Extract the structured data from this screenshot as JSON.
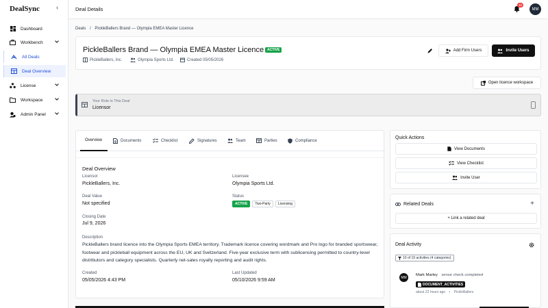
{
  "app": {
    "brand": "DealSync",
    "page_title": "Deal Details",
    "notification_count": "10",
    "user_initials": "MM"
  },
  "sidebar": {
    "items": [
      {
        "label": "Dashboard",
        "icon": "dashboard-icon"
      },
      {
        "label": "Workbench",
        "icon": "briefcase-icon",
        "expandable": true
      },
      {
        "label": "All Deals",
        "icon": "handshake-icon",
        "sub": true
      },
      {
        "label": "Deal Overview",
        "icon": "building-icon",
        "sub": true,
        "active": true
      },
      {
        "label": "License",
        "icon": "share-icon",
        "expandable": true
      },
      {
        "label": "Workspace",
        "icon": "folder-icon",
        "expandable": true
      },
      {
        "label": "Admin Panel",
        "icon": "shield-user-icon",
        "expandable": true
      }
    ]
  },
  "breadcrumb": {
    "root": "Deals",
    "separator": "/",
    "current": "PickleBallers Brand — Olympia EMEA Master Licence"
  },
  "deal": {
    "title": "PickleBallers Brand — Olympia EMEA Master Licence",
    "status": "ACTIVE",
    "licensor_meta": "PickleBallers, Inc.",
    "licensee_meta": "Olympia Sports Ltd.",
    "created_meta": "Created 05/05/2026"
  },
  "actions": {
    "add_firm_users": "Add Firm Users",
    "invite_users": "Invite Users",
    "open_workspace": "Open licence workspace"
  },
  "role": {
    "label": "Your Role in This Deal",
    "value": "Licensor"
  },
  "tabs": [
    "Overview",
    "Documents",
    "Checklist",
    "Signatures",
    "Team",
    "Parties",
    "Compliance"
  ],
  "overview": {
    "section_title": "Deal Overview",
    "licensor_label": "Licensor",
    "licensor_value": "PickleBallers, Inc.",
    "licensee_label": "Licensee",
    "licensee_value": "Olympia Sports Ltd.",
    "deal_value_label": "Deal Value",
    "deal_value": "Not specified",
    "status_label": "Status",
    "status_pills": [
      "ACTIVE",
      "Two-Party",
      "Licensing"
    ],
    "closing_label": "Closing Date",
    "closing_value": "Jul 9, 2026",
    "description_label": "Description",
    "description": "PickleBallers brand licence into the Olympia Sports EMEA territory. Trademark licence covering wordmark and Pro logo for branded sportswear, footwear and pickleball equipment across the EU, UK and Switzerland. Five-year exclusive term with sublicensing permitted to country-level distributors and category specialists. Quarterly net-sales royalty reporting and audit rights.",
    "created_label": "Created",
    "created_value": "05/05/2026 4:43 PM",
    "updated_label": "Last Updated",
    "updated_value": "05/10/2026 9:59 AM"
  },
  "quick_actions": {
    "title": "Quick Actions",
    "view_documents": "View Documents",
    "view_checklist": "View Checklist",
    "invite_user": "Invite User"
  },
  "related": {
    "title": "Related Deals",
    "link_label": "+ Link a related deal"
  },
  "activity": {
    "title": "Deal Activity",
    "filter": "10 of 19 activities (4 categories)",
    "entries": [
      {
        "initials": "MM",
        "user": "Mark Marley",
        "action": "sense check completed",
        "tag": "DOCUMENT_ACTIVITIES",
        "time": "about 22 hours ago",
        "org": "PickleBallers"
      }
    ]
  }
}
